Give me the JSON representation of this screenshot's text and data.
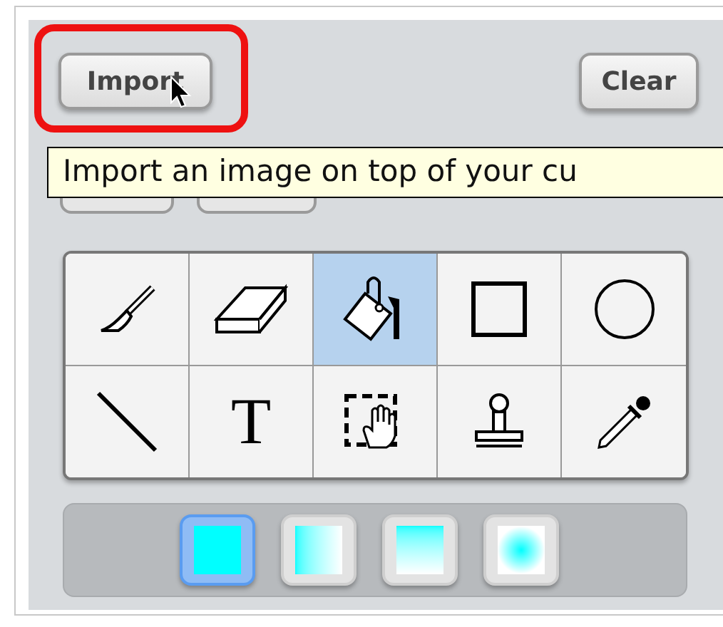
{
  "buttons": [
    {
      "label": "Import"
    },
    {
      "label": "Clear"
    }
  ],
  "tooltip": {
    "text": "Import an image on top of your cu"
  },
  "tools": [
    {
      "kind": "brush",
      "selected": false
    },
    {
      "kind": "eraser",
      "selected": false
    },
    {
      "kind": "fill",
      "selected": true
    },
    {
      "kind": "rectangle",
      "selected": false
    },
    {
      "kind": "ellipse",
      "selected": false
    },
    {
      "kind": "line",
      "selected": false
    },
    {
      "kind": "text",
      "label": "T",
      "selected": false
    },
    {
      "kind": "select",
      "selected": false
    },
    {
      "kind": "stamp",
      "selected": false
    },
    {
      "kind": "eyedropper",
      "selected": false
    }
  ],
  "fill_modes": [
    {
      "kind": "solid",
      "selected": true
    },
    {
      "kind": "horizontal",
      "selected": false
    },
    {
      "kind": "vertical",
      "selected": false
    },
    {
      "kind": "radial",
      "selected": false
    }
  ]
}
